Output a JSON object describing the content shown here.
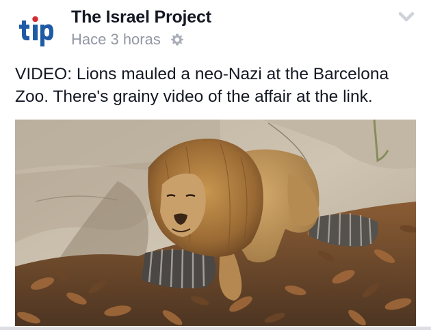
{
  "post": {
    "page_name": "The Israel Project",
    "avatar_text": "tip",
    "timestamp": "Hace 3 horas",
    "privacy_icon": "gear-icon",
    "options_icon": "chevron-down-icon",
    "text": "VIDEO: Lions mauled a neo-Nazi at the Barcelona Zoo. There's grainy video of the affair at the link.",
    "photo_subject": "lion-among-autumn-leaves"
  },
  "colors": {
    "brand_blue": "#1f5aa6",
    "brand_red": "#d42a33",
    "name_text": "#141823",
    "meta_text": "#9197a3"
  }
}
